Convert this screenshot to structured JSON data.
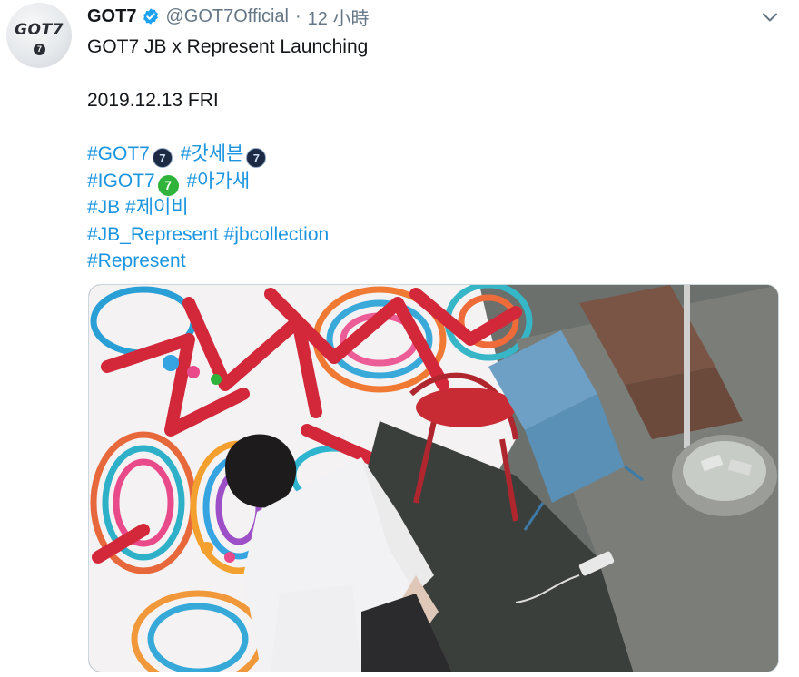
{
  "tweet": {
    "display_name": "GOT7",
    "handle": "@GOT7Official",
    "separator": "·",
    "time": "12 小時",
    "avatar_text": "GOT7",
    "avatar_badge": "7",
    "lines": {
      "title": "GOT7 JB x Represent Launching",
      "date": "2019.12.13 FRI",
      "h_got7": "#GOT7",
      "h_gatsebeun": "#갓세븐",
      "h_igot7": "#IGOT7",
      "h_agasae": "#아가새",
      "h_jb": "#JB",
      "h_jeibi": "#제이비",
      "h_jb_represent": "#JB_Represent",
      "h_jbcollection": "#jbcollection",
      "h_represent": "#Represent"
    },
    "emoji_badge": "7"
  },
  "icons": {
    "verified": "verified-badge-icon",
    "caret": "chevron-down-icon"
  },
  "colors": {
    "link": "#1b95e0",
    "verified": "#1da1f2",
    "text": "#14171a",
    "secondary": "#657786",
    "igot7_green": "#2fb33a"
  }
}
